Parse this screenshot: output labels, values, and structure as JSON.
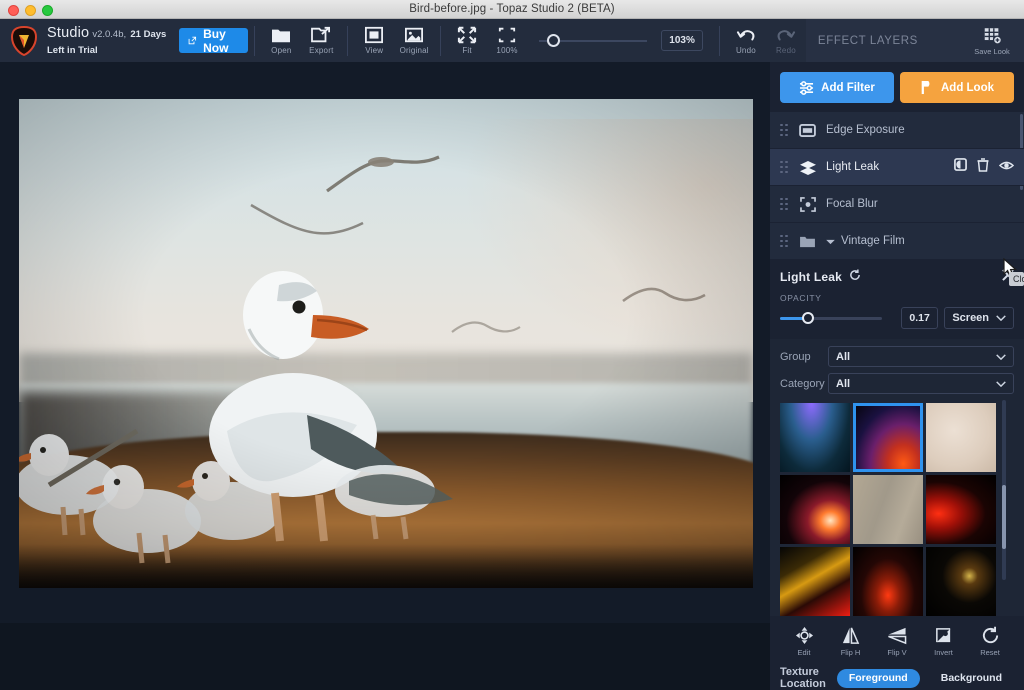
{
  "window": {
    "title": "Bird-before.jpg - Topaz Studio 2 (BETA)",
    "controls": [
      "close",
      "minimize",
      "maximize"
    ]
  },
  "brand": {
    "name": "Studio",
    "version": "v2.0.4b,",
    "trial": "21 Days Left in Trial",
    "buy_label": "Buy Now",
    "logo_icon": "topaz-logo-icon"
  },
  "toolbar": {
    "buttons": [
      {
        "label": "Open",
        "icon": "folder-icon",
        "enabled": true
      },
      {
        "label": "Export",
        "icon": "export-icon",
        "enabled": true
      },
      {
        "label": "View",
        "icon": "view-square-icon",
        "enabled": true
      },
      {
        "label": "Original",
        "icon": "original-image-icon",
        "enabled": true
      },
      {
        "label": "Fit",
        "icon": "fit-icon",
        "enabled": true
      },
      {
        "label": "100%",
        "icon": "actual-size-icon",
        "enabled": true
      }
    ],
    "zoom": {
      "value": "103%",
      "slider_percent": 8
    },
    "history": [
      {
        "label": "Undo",
        "icon": "undo-icon",
        "enabled": true
      },
      {
        "label": "Redo",
        "icon": "redo-icon",
        "enabled": false
      }
    ]
  },
  "panel": {
    "header": "EFFECT LAYERS",
    "save_look": {
      "label": "Save Look",
      "icon": "save-look-icon"
    },
    "add_filter": {
      "label": "Add Filter",
      "icon": "sliders-icon",
      "color": "#3d96ec"
    },
    "add_look": {
      "label": "Add Look",
      "icon": "look-icon",
      "color": "#f5a33f"
    },
    "layers": [
      {
        "name": "Edge Exposure",
        "icon": "edge-exposure-icon",
        "selected": false,
        "group": false
      },
      {
        "name": "Light Leak",
        "icon": "light-leak-icon",
        "selected": true,
        "group": false
      },
      {
        "name": "Focal Blur",
        "icon": "focal-blur-icon",
        "selected": false,
        "group": false
      },
      {
        "name": "Vintage Film",
        "icon": "folder-icon",
        "selected": false,
        "group": true
      }
    ],
    "layer_actions": [
      "mask-icon",
      "trash-icon",
      "eye-icon"
    ]
  },
  "filter": {
    "title": "Light Leak",
    "reset_icon": "reset-circular-arrow-icon",
    "close_icon": "close-x-icon",
    "close_tooltip": "Close",
    "opacity_label": "OPACITY",
    "opacity_value": "0.17",
    "opacity_percent": 17,
    "blend_mode": "Screen",
    "selects": [
      {
        "label": "Group",
        "value": "All"
      },
      {
        "label": "Category",
        "value": "All"
      }
    ],
    "thumbnails": [
      {
        "id": "leak-blue-purple",
        "selected": false
      },
      {
        "id": "leak-red-purple-glow",
        "selected": true
      },
      {
        "id": "texture-paper-light",
        "selected": false
      },
      {
        "id": "leak-warm-flare",
        "selected": false
      },
      {
        "id": "texture-concrete",
        "selected": false
      },
      {
        "id": "leak-red-streak",
        "selected": false
      },
      {
        "id": "leak-amber-red",
        "selected": false
      },
      {
        "id": "leak-red-column",
        "selected": false
      },
      {
        "id": "leak-lens-flare-dots",
        "selected": false
      }
    ],
    "tools": [
      {
        "label": "Edit",
        "icon": "edit-move-icon"
      },
      {
        "label": "Flip H",
        "icon": "flip-horizontal-icon"
      },
      {
        "label": "Flip V",
        "icon": "flip-vertical-icon"
      },
      {
        "label": "Invert",
        "icon": "invert-icon"
      },
      {
        "label": "Reset",
        "icon": "reset-icon"
      }
    ],
    "texture_location": {
      "label": "Texture Location",
      "options": [
        "Foreground",
        "Background"
      ],
      "selected": "Foreground"
    }
  },
  "canvas": {
    "image_alt": "Bird-before.jpg — flock of seagulls on a shoreline at golden hour"
  },
  "colors": {
    "accent_blue": "#3d96ec",
    "accent_orange": "#f5a33f",
    "panel_bg": "#1b2232",
    "toolbar_bg": "#232c3d",
    "canvas_bg": "#131b28"
  }
}
